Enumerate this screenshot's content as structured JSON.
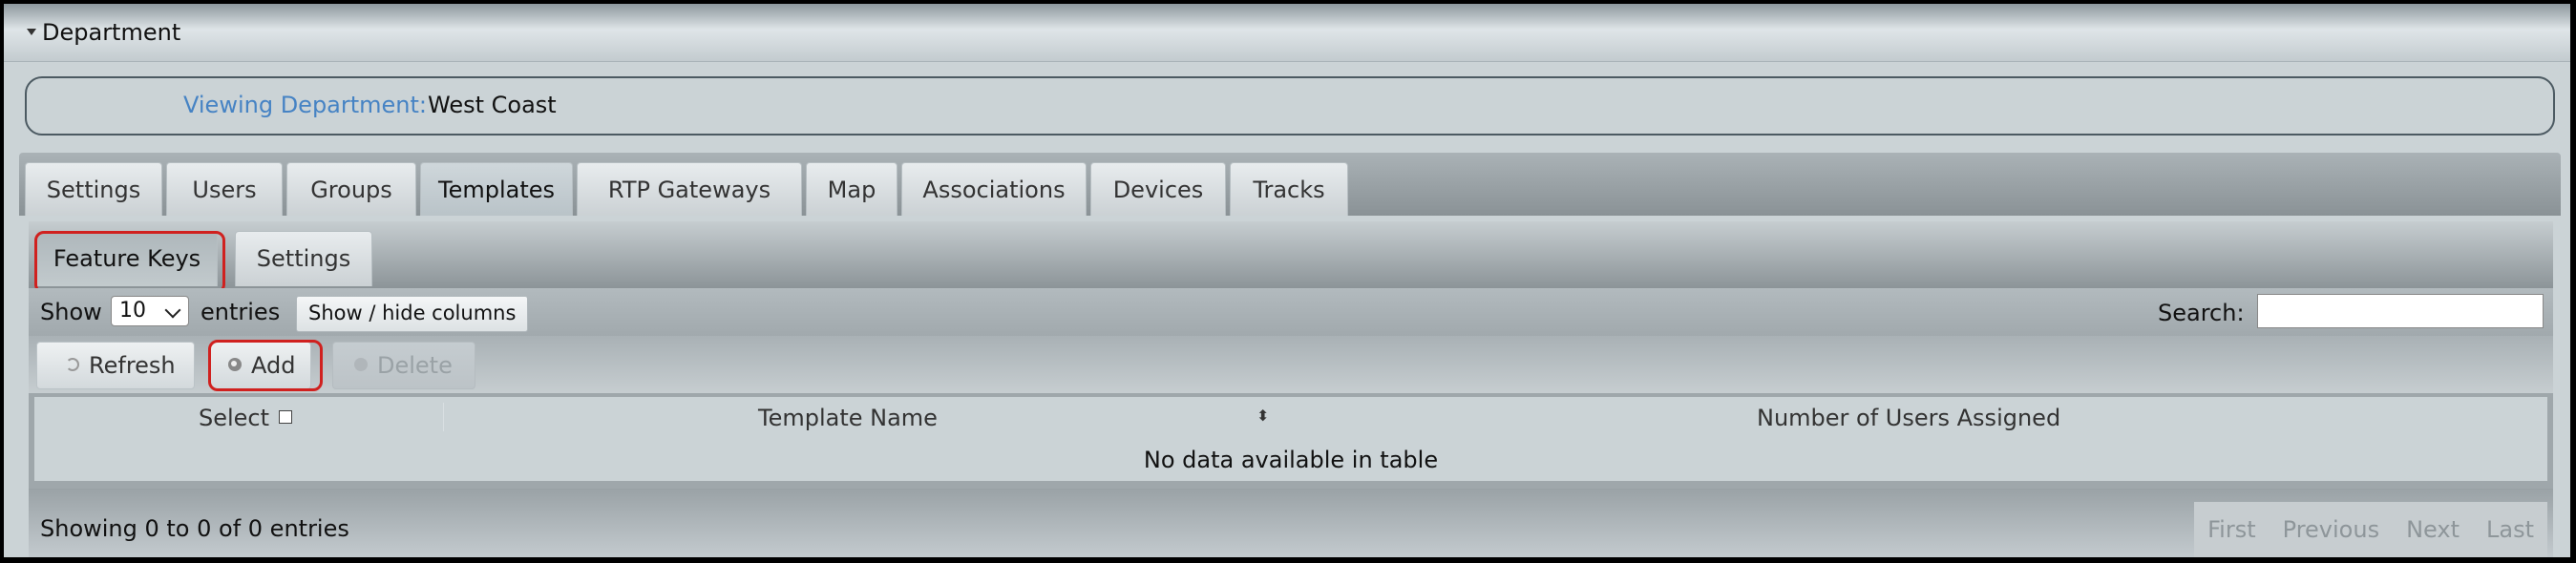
{
  "section": {
    "title": "Department"
  },
  "viewing": {
    "label": "Viewing Department:",
    "value": "West Coast"
  },
  "main_tabs": [
    {
      "label": "Settings"
    },
    {
      "label": "Users"
    },
    {
      "label": "Groups"
    },
    {
      "label": "Templates",
      "active": true
    },
    {
      "label": "RTP Gateways"
    },
    {
      "label": "Map"
    },
    {
      "label": "Associations"
    },
    {
      "label": "Devices"
    },
    {
      "label": "Tracks"
    }
  ],
  "sub_tabs": [
    {
      "label": "Feature Keys",
      "active": true
    },
    {
      "label": "Settings"
    }
  ],
  "table_controls": {
    "show_label": "Show",
    "page_size": "10",
    "entries_label": "entries",
    "columns_button": "Show / hide columns",
    "search_label": "Search:",
    "search_value": ""
  },
  "toolbar": {
    "refresh": "Refresh",
    "add": "Add",
    "delete": "Delete"
  },
  "table": {
    "columns": [
      "Select",
      "Template Name",
      "Number of Users Assigned"
    ],
    "empty_message": "No data available in table"
  },
  "footer": {
    "info": "Showing 0 to 0 of 0 entries",
    "pager": [
      "First",
      "Previous",
      "Next",
      "Last"
    ]
  },
  "colors": {
    "highlight": "#d0211f",
    "label_blue": "#4683c4"
  }
}
